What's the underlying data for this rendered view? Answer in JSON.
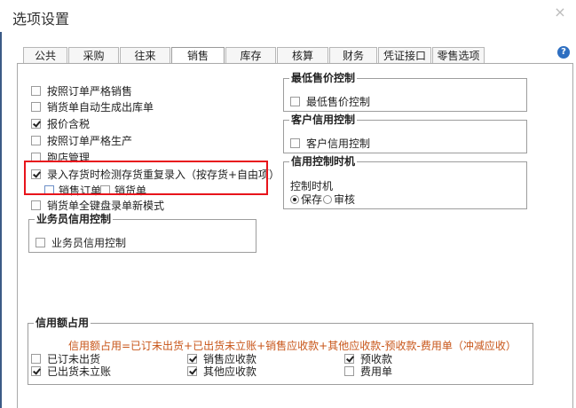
{
  "window": {
    "title": "选项设置",
    "close_symbol": "×"
  },
  "tabs": [
    {
      "label": "公共",
      "active": false
    },
    {
      "label": "采购",
      "active": false
    },
    {
      "label": "往来",
      "active": false
    },
    {
      "label": "销售",
      "active": true
    },
    {
      "label": "库存",
      "active": false
    },
    {
      "label": "核算",
      "active": false
    },
    {
      "label": "财务",
      "active": false
    },
    {
      "label": "凭证接口",
      "active": false
    },
    {
      "label": "零售选项",
      "active": false
    }
  ],
  "help_icon": "?",
  "left_options": [
    {
      "label": "按照订单严格销售",
      "checked": false
    },
    {
      "label": "销货单自动生成出库单",
      "checked": false
    },
    {
      "label": "报价含税",
      "checked": true
    },
    {
      "label": "按照订单严格生产",
      "checked": false
    },
    {
      "label": "跑店管理",
      "checked": false
    },
    {
      "label": "录入存货时检测存货重复录入（按存货+自由项）",
      "checked": true
    },
    {
      "label": "销售订单",
      "checked": false
    },
    {
      "label": "销货单",
      "checked": false
    },
    {
      "label": "销货单全键盘录单新模式",
      "checked": false
    }
  ],
  "salesperson_credit": {
    "title": "业务员信用控制",
    "option": {
      "label": "业务员信用控制",
      "checked": false
    }
  },
  "min_price": {
    "title": "最低售价控制",
    "option": {
      "label": "最低售价控制",
      "checked": false
    }
  },
  "customer_credit": {
    "title": "客户信用控制",
    "option": {
      "label": "客户信用控制",
      "checked": false
    }
  },
  "credit_timing": {
    "title": "信用控制时机",
    "label": "控制时机",
    "options": [
      {
        "label": "保存",
        "selected": true
      },
      {
        "label": "审核",
        "selected": false
      }
    ]
  },
  "credit_usage": {
    "title": "信用额占用",
    "formula": "信用额占用=已订未出货+已出货未立账+销售应收款+其他应收款-预收款-费用单（冲减应收）",
    "items": [
      {
        "label": "已订未出货",
        "checked": false
      },
      {
        "label": "已出货未立账",
        "checked": true
      },
      {
        "label": "销售应收款",
        "checked": true
      },
      {
        "label": "其他应收款",
        "checked": true
      },
      {
        "label": "预收款",
        "checked": true
      },
      {
        "label": "费用单",
        "checked": false
      }
    ]
  }
}
